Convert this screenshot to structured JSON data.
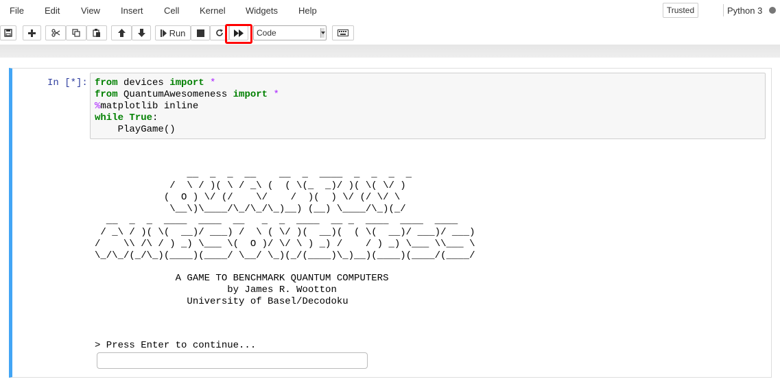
{
  "menubar": {
    "items": [
      "File",
      "Edit",
      "View",
      "Insert",
      "Cell",
      "Kernel",
      "Widgets",
      "Help"
    ],
    "trusted": "Trusted",
    "kernel": "Python 3"
  },
  "toolbar": {
    "run_label": "Run",
    "cell_type": "Code"
  },
  "cell": {
    "prompt": "In [*]:",
    "code": {
      "l1": {
        "a": "from",
        "b": " devices ",
        "c": "import",
        "d": " *"
      },
      "l2": {
        "a": "from",
        "b": " QuantumAwesomeness ",
        "c": "import",
        "d": " *"
      },
      "l3": {
        "a": "%",
        "b": "matplotlib inline"
      },
      "l4": {
        "a": "while",
        "b": " ",
        "c": "True",
        "d": ":"
      },
      "l5": "    PlayGame()"
    },
    "output": {
      "art": [
        "                __  _  _  __    __  _  ____  _  _  _  _",
        "             /  \\ / )( \\ / _\\ (  ( \\(_  _)/ )( \\( \\/ )",
        "            (  O ) \\/ (/    \\/    /  )(  ) \\/ (/ \\/ \\",
        "             \\__\\)\\____/\\_/\\_/\\_)__) (__) \\____/\\_)(_/",
        "",
        "  __  _  _  ____  ____  __   _  _  ____  __ _  ____  ____  ____",
        " / _\\ / )( \\(  __)/ ___) /  \\ ( \\/ )(  __)(  ( \\(  __)/ ___)/ ___)",
        "/    \\\\ /\\ / ) _) \\___ \\(  O )/ \\/ \\ ) _) /    / ) _) \\___ \\\\___ \\",
        "\\_/\\_/(_/\\_)(____)(____/ \\__/ \\_)(_/(____)\\_)__)(____)(____/(____/"
      ],
      "title": "              A GAME TO BENCHMARK QUANTUM COMPUTERS",
      "author": "                       by James R. Wootton",
      "affiliation": "                University of Basel/Decodoku",
      "prompt": "> Press Enter to continue..."
    }
  }
}
